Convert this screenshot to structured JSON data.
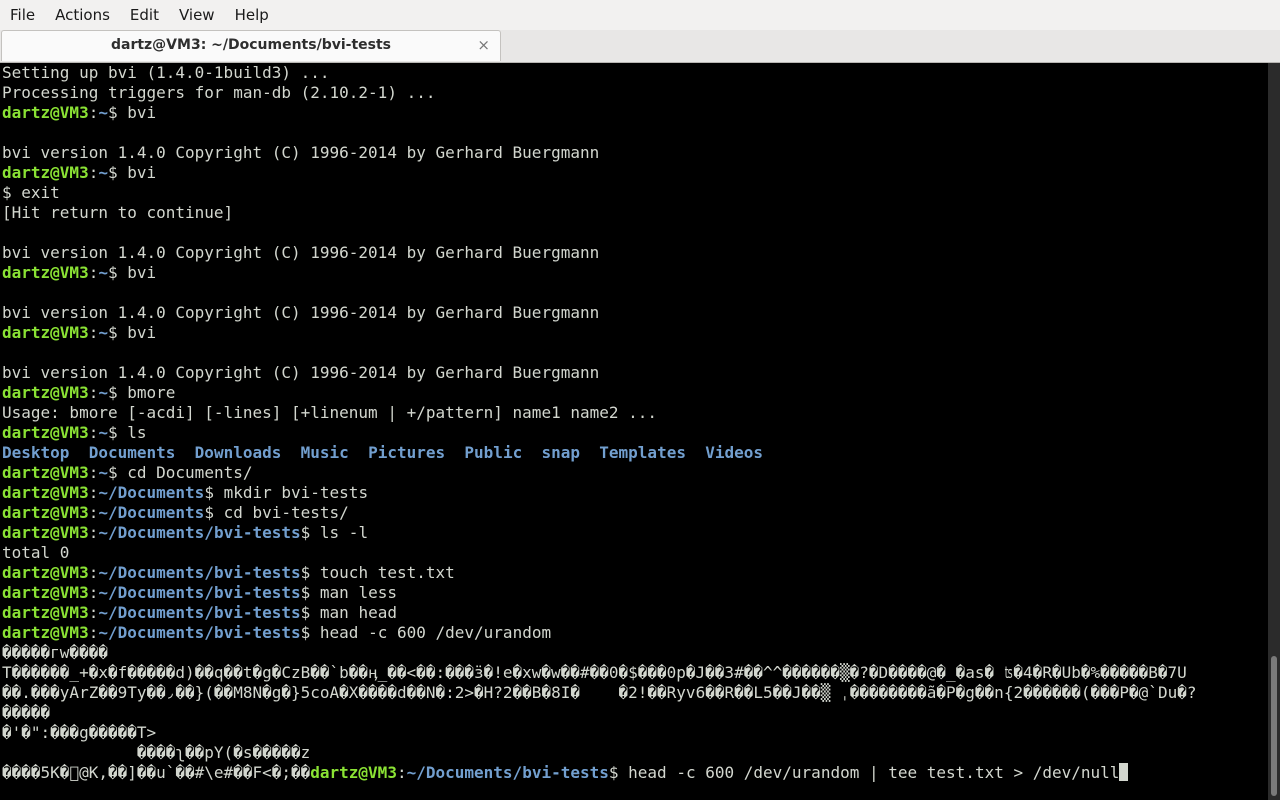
{
  "menubar": {
    "items": [
      "File",
      "Actions",
      "Edit",
      "View",
      "Help"
    ]
  },
  "tab": {
    "title": "dartz@VM3: ~/Documents/bvi-tests",
    "close_glyph": "×"
  },
  "colors": {
    "background": "#000000",
    "text": "#d3d7cf",
    "user_host": "#8ae234",
    "path": "#729fcf"
  },
  "terminal": {
    "lines": [
      [
        {
          "t": "Setting up bvi (1.4.0-1build3) ..."
        }
      ],
      [
        {
          "t": "Processing triggers for man-db (2.10.2-1) ..."
        }
      ],
      [
        {
          "t": "dartz@VM3",
          "c": "user"
        },
        {
          "t": ":"
        },
        {
          "t": "~",
          "c": "path"
        },
        {
          "t": "$ bvi"
        }
      ],
      [],
      [
        {
          "t": "bvi version 1.4.0 Copyright (C) 1996-2014 by Gerhard Buergmann"
        }
      ],
      [
        {
          "t": "dartz@VM3",
          "c": "user"
        },
        {
          "t": ":"
        },
        {
          "t": "~",
          "c": "path"
        },
        {
          "t": "$ bvi"
        }
      ],
      [
        {
          "t": "$ exit"
        }
      ],
      [
        {
          "t": "[Hit return to continue]"
        }
      ],
      [],
      [
        {
          "t": "bvi version 1.4.0 Copyright (C) 1996-2014 by Gerhard Buergmann"
        }
      ],
      [
        {
          "t": "dartz@VM3",
          "c": "user"
        },
        {
          "t": ":"
        },
        {
          "t": "~",
          "c": "path"
        },
        {
          "t": "$ bvi"
        }
      ],
      [],
      [
        {
          "t": "bvi version 1.4.0 Copyright (C) 1996-2014 by Gerhard Buergmann"
        }
      ],
      [
        {
          "t": "dartz@VM3",
          "c": "user"
        },
        {
          "t": ":"
        },
        {
          "t": "~",
          "c": "path"
        },
        {
          "t": "$ bvi"
        }
      ],
      [],
      [
        {
          "t": "bvi version 1.4.0 Copyright (C) 1996-2014 by Gerhard Buergmann"
        }
      ],
      [
        {
          "t": "dartz@VM3",
          "c": "user"
        },
        {
          "t": ":"
        },
        {
          "t": "~",
          "c": "path"
        },
        {
          "t": "$ bmore"
        }
      ],
      [
        {
          "t": "Usage: bmore [-acdi] [-lines] [+linenum | +/pattern] name1 name2 ..."
        }
      ],
      [
        {
          "t": "dartz@VM3",
          "c": "user"
        },
        {
          "t": ":"
        },
        {
          "t": "~",
          "c": "path"
        },
        {
          "t": "$ ls"
        }
      ],
      [
        {
          "t": "Desktop",
          "c": "dir"
        },
        {
          "t": "  "
        },
        {
          "t": "Documents",
          "c": "dir"
        },
        {
          "t": "  "
        },
        {
          "t": "Downloads",
          "c": "dir"
        },
        {
          "t": "  "
        },
        {
          "t": "Music",
          "c": "dir"
        },
        {
          "t": "  "
        },
        {
          "t": "Pictures",
          "c": "dir"
        },
        {
          "t": "  "
        },
        {
          "t": "Public",
          "c": "dir"
        },
        {
          "t": "  "
        },
        {
          "t": "snap",
          "c": "dir"
        },
        {
          "t": "  "
        },
        {
          "t": "Templates",
          "c": "dir"
        },
        {
          "t": "  "
        },
        {
          "t": "Videos",
          "c": "dir"
        }
      ],
      [
        {
          "t": "dartz@VM3",
          "c": "user"
        },
        {
          "t": ":"
        },
        {
          "t": "~",
          "c": "path"
        },
        {
          "t": "$ cd Documents/"
        }
      ],
      [
        {
          "t": "dartz@VM3",
          "c": "user"
        },
        {
          "t": ":"
        },
        {
          "t": "~/Documents",
          "c": "path"
        },
        {
          "t": "$ mkdir bvi-tests"
        }
      ],
      [
        {
          "t": "dartz@VM3",
          "c": "user"
        },
        {
          "t": ":"
        },
        {
          "t": "~/Documents",
          "c": "path"
        },
        {
          "t": "$ cd bvi-tests/"
        }
      ],
      [
        {
          "t": "dartz@VM3",
          "c": "user"
        },
        {
          "t": ":"
        },
        {
          "t": "~/Documents/bvi-tests",
          "c": "path"
        },
        {
          "t": "$ ls -l"
        }
      ],
      [
        {
          "t": "total 0"
        }
      ],
      [
        {
          "t": "dartz@VM3",
          "c": "user"
        },
        {
          "t": ":"
        },
        {
          "t": "~/Documents/bvi-tests",
          "c": "path"
        },
        {
          "t": "$ touch test.txt"
        }
      ],
      [
        {
          "t": "dartz@VM3",
          "c": "user"
        },
        {
          "t": ":"
        },
        {
          "t": "~/Documents/bvi-tests",
          "c": "path"
        },
        {
          "t": "$ man less"
        }
      ],
      [
        {
          "t": "dartz@VM3",
          "c": "user"
        },
        {
          "t": ":"
        },
        {
          "t": "~/Documents/bvi-tests",
          "c": "path"
        },
        {
          "t": "$ man head"
        }
      ],
      [
        {
          "t": "dartz@VM3",
          "c": "user"
        },
        {
          "t": ":"
        },
        {
          "t": "~/Documents/bvi-tests",
          "c": "path"
        },
        {
          "t": "$ head -c 600 /dev/urandom"
        }
      ],
      [
        {
          "t": "�����гw����"
        }
      ],
      [
        {
          "t": "T������_+�x�f�����d)��q��t�g�CzB��`b��ӊ_��<��:���ӟ�!e�xw�w��#��0�$���0p�J��3#��^^������▒�?�D����@�_�as� ʦ�4�R�Ub�%�����B�7U"
        }
      ],
      [
        {
          "t": "��.���yArZ��9Ty��◞��}(��M8N�g�}5coA�X����d��N�:2>�H?2��B�8I�    �2!��Ryv6��R��L5��J��▒ ˌ��������ã�P�g��n{2������(���P�@`Du�?"
        }
      ],
      [
        {
          "t": "�����"
        }
      ],
      [
        {
          "t": "�'�\":���g�����T>"
        }
      ],
      [
        {
          "t": "              ����ʅ��pY(�s�����z"
        }
      ],
      [
        {
          "t": "����5K�⃞@K,��]��u`��#\\e#��F<�;��"
        },
        {
          "t": "dartz@VM3",
          "c": "user"
        },
        {
          "t": ":"
        },
        {
          "t": "~/Documents/bvi-tests",
          "c": "path"
        },
        {
          "t": "$ head -c 600 /dev/urandom | tee test.txt > /dev/null"
        },
        {
          "cursor": true
        }
      ]
    ]
  }
}
